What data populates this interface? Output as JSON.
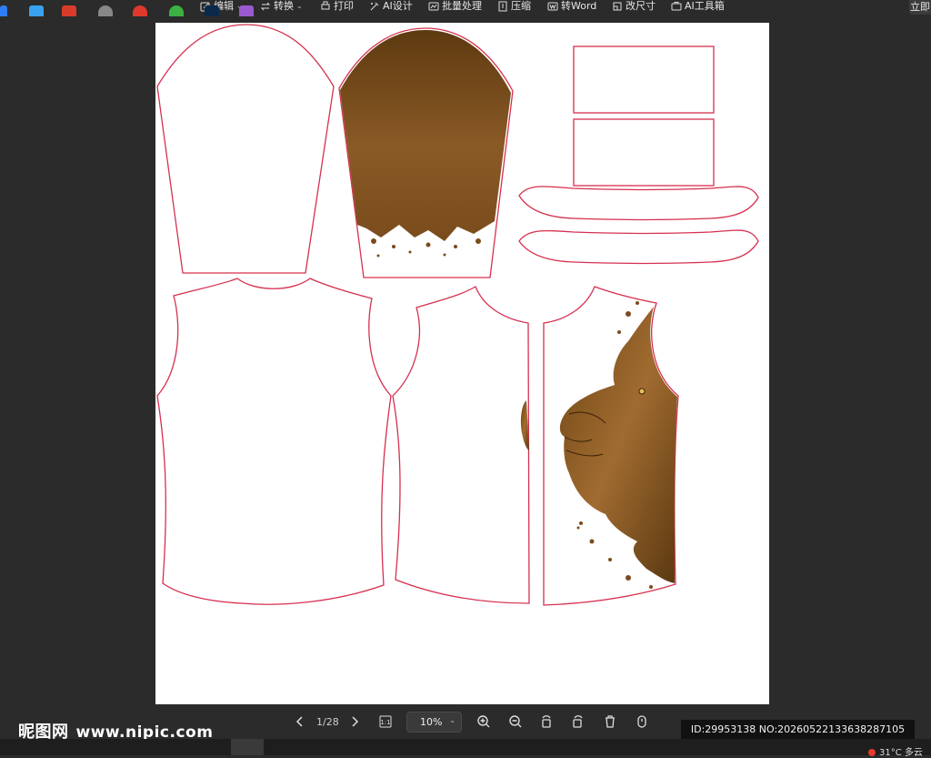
{
  "toolbar": {
    "items": [
      {
        "label": "编辑",
        "icon": "edit-icon",
        "dropdown": true
      },
      {
        "label": "转换",
        "icon": "convert-icon",
        "dropdown": true
      },
      {
        "label": "打印",
        "icon": "print-icon",
        "dropdown": false
      },
      {
        "label": "AI设计",
        "icon": "ai-design-icon",
        "dropdown": false
      },
      {
        "label": "批量处理",
        "icon": "batch-icon",
        "dropdown": false
      },
      {
        "label": "压缩",
        "icon": "compress-icon",
        "dropdown": false
      },
      {
        "label": "转Word",
        "icon": "word-icon",
        "dropdown": false
      },
      {
        "label": "改尺寸",
        "icon": "resize-icon",
        "dropdown": false
      },
      {
        "label": "AI工具箱",
        "icon": "ai-toolbox-icon",
        "dropdown": false
      }
    ],
    "right_label": "立即"
  },
  "viewer": {
    "page_indicator": "1/28",
    "zoom": "10%"
  },
  "watermark": {
    "cn": "昵图网",
    "url": "www.nipic.com"
  },
  "image_id": "ID:29953138 NO:20260522133638287105",
  "tray": {
    "weather": "31°C 多云"
  },
  "colors": {
    "outline": "#d6304f",
    "lion_brown": "#8a5a26",
    "background": "#2b2b2b"
  }
}
